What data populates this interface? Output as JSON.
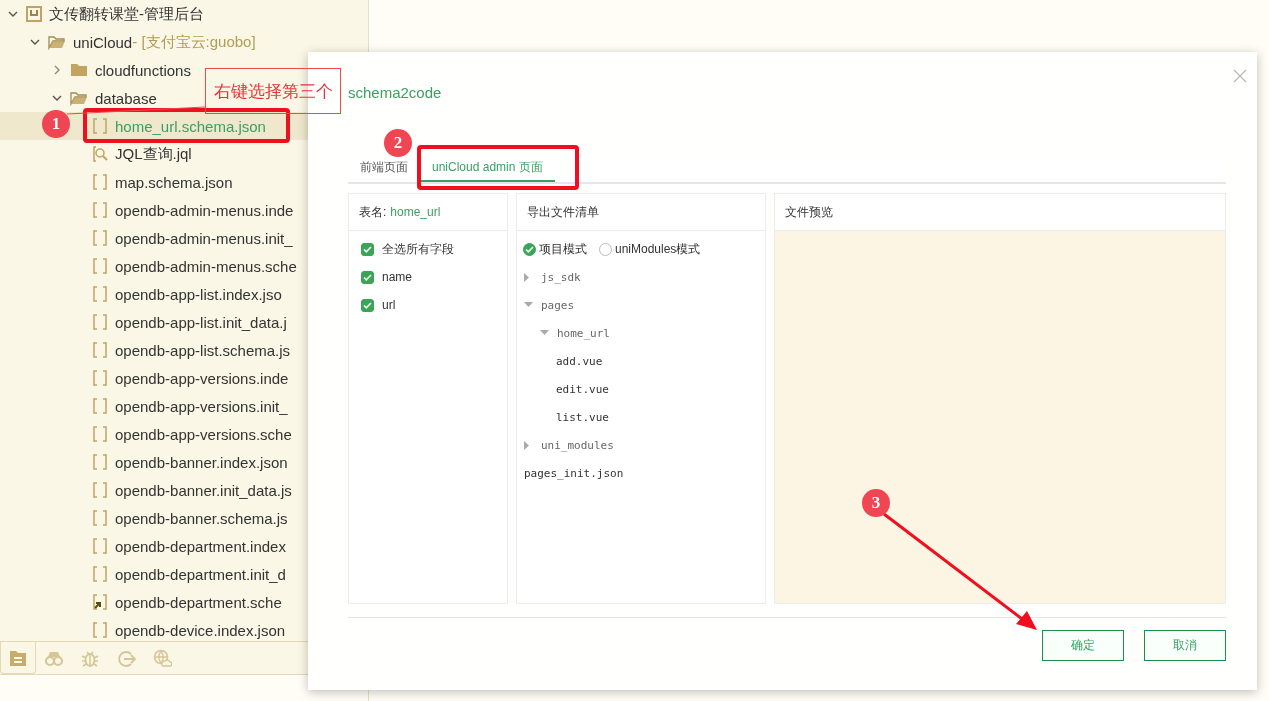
{
  "project_tree": [
    {
      "name": "文传翻转课堂-管理后台",
      "kind": "project",
      "expanded": true,
      "selected": false,
      "children": [
        {
          "name": "uniCloud",
          "suffix": " - [支付宝云:guobo]",
          "kind": "folder",
          "expanded": true,
          "selected": false,
          "children": [
            {
              "name": "cloudfunctions",
              "kind": "folder",
              "expanded": false,
              "selected": false
            },
            {
              "name": "database",
              "kind": "folder",
              "expanded": true,
              "selected": false,
              "children": [
                {
                  "name": "home_url.schema.json",
                  "kind": "file",
                  "selected": true
                },
                {
                  "name": "JQL查询.jql",
                  "kind": "query",
                  "selected": false
                },
                {
                  "name": "map.schema.json",
                  "kind": "file",
                  "selected": false
                },
                {
                  "name": "opendb-admin-menus.inde",
                  "kind": "file",
                  "selected": false
                },
                {
                  "name": "opendb-admin-menus.init_",
                  "kind": "file",
                  "selected": false
                },
                {
                  "name": "opendb-admin-menus.sche",
                  "kind": "file",
                  "selected": false
                },
                {
                  "name": "opendb-app-list.index.jso",
                  "kind": "file",
                  "selected": false
                },
                {
                  "name": "opendb-app-list.init_data.j",
                  "kind": "file",
                  "selected": false
                },
                {
                  "name": "opendb-app-list.schema.js",
                  "kind": "file",
                  "selected": false
                },
                {
                  "name": "opendb-app-versions.inde",
                  "kind": "file",
                  "selected": false
                },
                {
                  "name": "opendb-app-versions.init_",
                  "kind": "file",
                  "selected": false
                },
                {
                  "name": "opendb-app-versions.sche",
                  "kind": "file",
                  "selected": false
                },
                {
                  "name": "opendb-banner.index.json",
                  "kind": "file",
                  "selected": false
                },
                {
                  "name": "opendb-banner.init_data.js",
                  "kind": "file",
                  "selected": false
                },
                {
                  "name": "opendb-banner.schema.js",
                  "kind": "file",
                  "selected": false
                },
                {
                  "name": "opendb-department.index",
                  "kind": "file",
                  "selected": false
                },
                {
                  "name": "opendb-department.init_d",
                  "kind": "file",
                  "selected": false
                },
                {
                  "name": "opendb-department.sche",
                  "kind": "linked",
                  "selected": false
                },
                {
                  "name": "opendb-device.index.json",
                  "kind": "file",
                  "selected": false
                }
              ]
            }
          ]
        }
      ]
    }
  ],
  "sidebar_toolbar": [
    {
      "kind": "files",
      "selected": true
    },
    {
      "kind": "binoculars",
      "selected": false
    },
    {
      "kind": "bug",
      "selected": false
    },
    {
      "kind": "export",
      "selected": false
    },
    {
      "kind": "cloud",
      "selected": false
    }
  ],
  "dialog": {
    "title": "schema2code",
    "tabs": [
      {
        "label": "前端页面",
        "selected": false
      },
      {
        "label": "uniCloud admin 页面",
        "selected": true
      }
    ],
    "table_name": {
      "label": "表名:",
      "value": "home_url"
    },
    "fields": [
      {
        "label": "全选所有字段",
        "checked": true
      },
      {
        "label": "name",
        "checked": true
      },
      {
        "label": "url",
        "checked": true
      }
    ],
    "export_title": "导出文件清单",
    "modes": [
      {
        "label": "项目模式",
        "selected": true
      },
      {
        "label": "uniModules模式",
        "selected": false
      }
    ],
    "export_tree": [
      {
        "name": "js_sdk",
        "expanded": false
      },
      {
        "name": "pages",
        "expanded": true,
        "children": [
          {
            "name": "home_url",
            "expanded": true,
            "children": [
              {
                "name": "add.vue"
              },
              {
                "name": "edit.vue"
              },
              {
                "name": "list.vue"
              }
            ]
          }
        ]
      },
      {
        "name": "uni_modules",
        "expanded": false
      },
      {
        "name": "pages_init.json"
      }
    ],
    "preview_title": "文件预览",
    "buttons": [
      {
        "label": "确定"
      },
      {
        "label": "取消"
      }
    ]
  },
  "annotations": [
    {
      "kind": "marker",
      "label": "1"
    },
    {
      "kind": "callout",
      "text": "右键选择第三个"
    },
    {
      "kind": "marker",
      "label": "2"
    },
    {
      "kind": "marker",
      "label": "3"
    }
  ]
}
